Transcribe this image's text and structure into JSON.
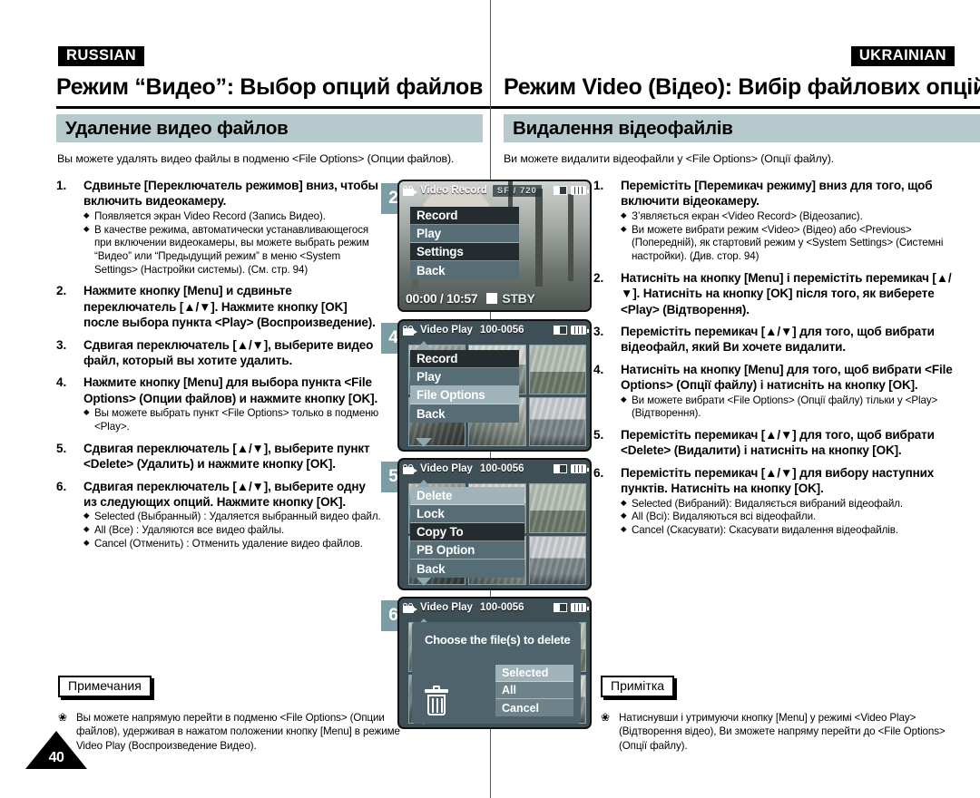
{
  "page": {
    "number": "40"
  },
  "russian": {
    "lang_tag": "RUSSIAN",
    "chapter_title": "Режим “Видео”: Выбор опций файлов",
    "section_title": "Удаление видео файлов",
    "intro": "Вы можете удалять видео файлы в подменю <File Options> (Опции файлов).",
    "steps": [
      {
        "num": "1.",
        "head": "Сдвиньте [Переключатель режимов] вниз, чтобы включить видеокамеру.",
        "bullets": [
          "Появляется экран Video Record (Запись Видео).",
          "В качестве режима, автоматически устанавливающегося при включении видеокамеры, вы можете выбрать режим “Видео” или “Предыдущий режим” в меню <System Settings> (Настройки системы). (См. стр. 94)"
        ]
      },
      {
        "num": "2.",
        "head": "Нажмите кнопку [Menu] и сдвиньте переключатель [▲/▼]. Нажмите кнопку [OK] после выбора пункта <Play> (Воспроизведение).",
        "bullets": []
      },
      {
        "num": "3.",
        "head": "Сдвигая переключатель [▲/▼], выберите видео файл, который вы хотите удалить.",
        "bullets": []
      },
      {
        "num": "4.",
        "head": "Нажмите кнопку [Menu] для выбора пункта <File Options> (Опции файлов) и нажмите кнопку [OK].",
        "bullets": [
          "Вы можете выбрать пункт <File Options> только в подменю <Play>."
        ]
      },
      {
        "num": "5.",
        "head": "Сдвигая переключатель [▲/▼], выберите пункт <Delete> (Удалить) и нажмите кнопку [OK].",
        "bullets": []
      },
      {
        "num": "6.",
        "head": "Сдвигая переключатель [▲/▼], выберите одну из следующих опций. Нажмите кнопку [OK].",
        "bullets": [
          "Selected (Выбранный) : Удаляется выбранный видео файл.",
          "All (Все) : Удаляются все видео файлы.",
          "Cancel (Отменить) : Отменить удаление видео файлов."
        ]
      }
    ],
    "note_label": "Примечания",
    "note_mark": "❀",
    "note_text": "Вы можете напрямую перейти в подменю <File Options> (Опции файлов), удерживая в нажатом положении кнопку [Menu] в режиме Video Play (Воспроизведение Видео)."
  },
  "ukrainian": {
    "lang_tag": "UKRAINIAN",
    "chapter_title": "Режим Video (Відео): Вибір файлових опцій",
    "section_title": "Видалення відеофайлів",
    "intro": "Ви можете видалити відеофайли у <File Options> (Опції файлу).",
    "steps": [
      {
        "num": "1.",
        "head": "Перемістіть [Перемикач режиму] вниз для того, щоб включити відеокамеру.",
        "bullets": [
          "З’являється екран <Video Record> (Відеозапис).",
          "Ви можете вибрати режим <Video> (Відео) або <Previous> (Попередній), як стартовий режим у <System Settings> (Системні настройки). (Див. стор. 94)"
        ]
      },
      {
        "num": "2.",
        "head": "Натисніть на кнопку [Menu] і перемістіть перемикач [▲/▼]. Натисніть на кнопку [OK] після того, як виберете <Play> (Відтворення).",
        "bullets": []
      },
      {
        "num": "3.",
        "head": "Перемістіть перемикач [▲/▼] для того, щоб вибрати відеофайл, який Ви хочете видалити.",
        "bullets": []
      },
      {
        "num": "4.",
        "head": "Натисніть на кнопку [Menu] для того, щоб вибрати <File Options> (Опції файлу) і натисніть на кнопку [OK].",
        "bullets": [
          "Ви можете вибрати <File Options> (Опції файлу) тільки у <Play> (Відтворення)."
        ]
      },
      {
        "num": "5.",
        "head": "Перемістіть перемикач [▲/▼] для того, щоб вибрати <Delete> (Видалити) і натисніть на кнопку [OK].",
        "bullets": []
      },
      {
        "num": "6.",
        "head": "Перемістіть перемикач [▲/▼] для вибору наступних пунктів. Натисніть на кнопку [OK].",
        "bullets": [
          "Selected (Вибраний): Видаляється вибраний відеофайл.",
          "All (Всі): Видаляються всі відеофайли.",
          "Cancel (Скасувати): Скасувати видалення відеофайлів."
        ]
      }
    ],
    "note_label": "Примітка",
    "note_mark": "❀",
    "note_text": "Натиснувши і утримуючи кнопку [Menu] у режимі <Video Play> (Відтворення відео), Ви зможете напряму перейти до <File Options> (Опції файлу)."
  },
  "screens": [
    {
      "badge": "2",
      "title": "Video Record",
      "fileno": "",
      "quality": "SF  /  720",
      "menu": [
        {
          "label": "Record",
          "state": "dark"
        },
        {
          "label": "Play",
          "state": "mid"
        },
        {
          "label": "Settings",
          "state": "dark"
        },
        {
          "label": "Back",
          "state": "mid"
        }
      ],
      "timecode": "00:00 / 10:57",
      "stby": "STBY"
    },
    {
      "badge": "4",
      "title": "Video Play",
      "fileno": "100-0056",
      "quality": "",
      "menu": [
        {
          "label": "Record",
          "state": "dark"
        },
        {
          "label": "Play",
          "state": "mid"
        },
        {
          "label": "File Options",
          "state": "light"
        },
        {
          "label": "Back",
          "state": "mid"
        }
      ],
      "timecode": "",
      "stby": ""
    },
    {
      "badge": "5",
      "title": "Video Play",
      "fileno": "100-0056",
      "quality": "",
      "menu": [
        {
          "label": "Delete",
          "state": "light"
        },
        {
          "label": "Lock",
          "state": "mid"
        },
        {
          "label": "Copy To",
          "state": "dark"
        },
        {
          "label": "PB Option",
          "state": "mid"
        },
        {
          "label": "Back",
          "state": "mid"
        }
      ],
      "timecode": "",
      "stby": ""
    },
    {
      "badge": "6",
      "title": "Video Play",
      "fileno": "100-0056",
      "quality": "",
      "dialog_title": "Choose the file(s) to delete",
      "dialog_options": [
        {
          "label": "Selected",
          "state": "sel"
        },
        {
          "label": "All",
          "state": "norm"
        },
        {
          "label": "Cancel",
          "state": "norm"
        }
      ],
      "timecode": "",
      "stby": ""
    }
  ],
  "colors": {
    "section_bar": "#b6c9cd",
    "step_badge": "#7d9da5",
    "lcd_menu_dark": "#242c30",
    "lcd_menu_mid": "#566d75",
    "lcd_menu_light": "#9fb3b8"
  }
}
